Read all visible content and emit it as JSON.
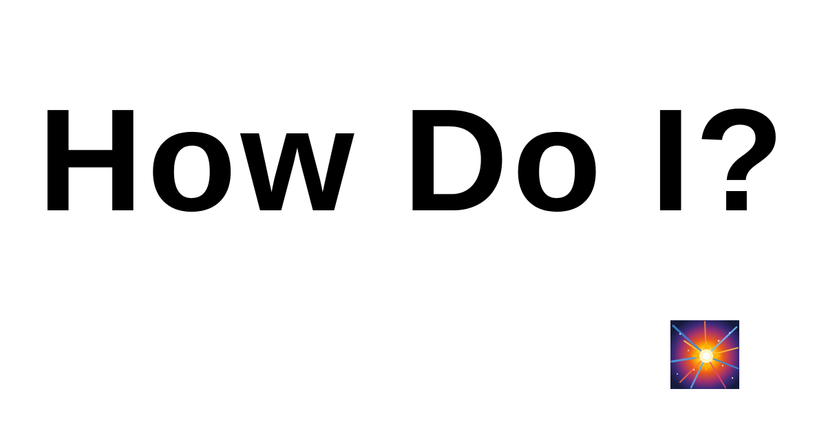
{
  "headline": "How Do I?",
  "logo": {
    "icon": "colorful-explosion-icon",
    "colors": {
      "background": "#141a3a",
      "core": "#fff4c2",
      "inner": "#ffb300",
      "mid": "#e8571e",
      "outer": "#6a2fa0",
      "rays": "#3b8ed9"
    }
  }
}
